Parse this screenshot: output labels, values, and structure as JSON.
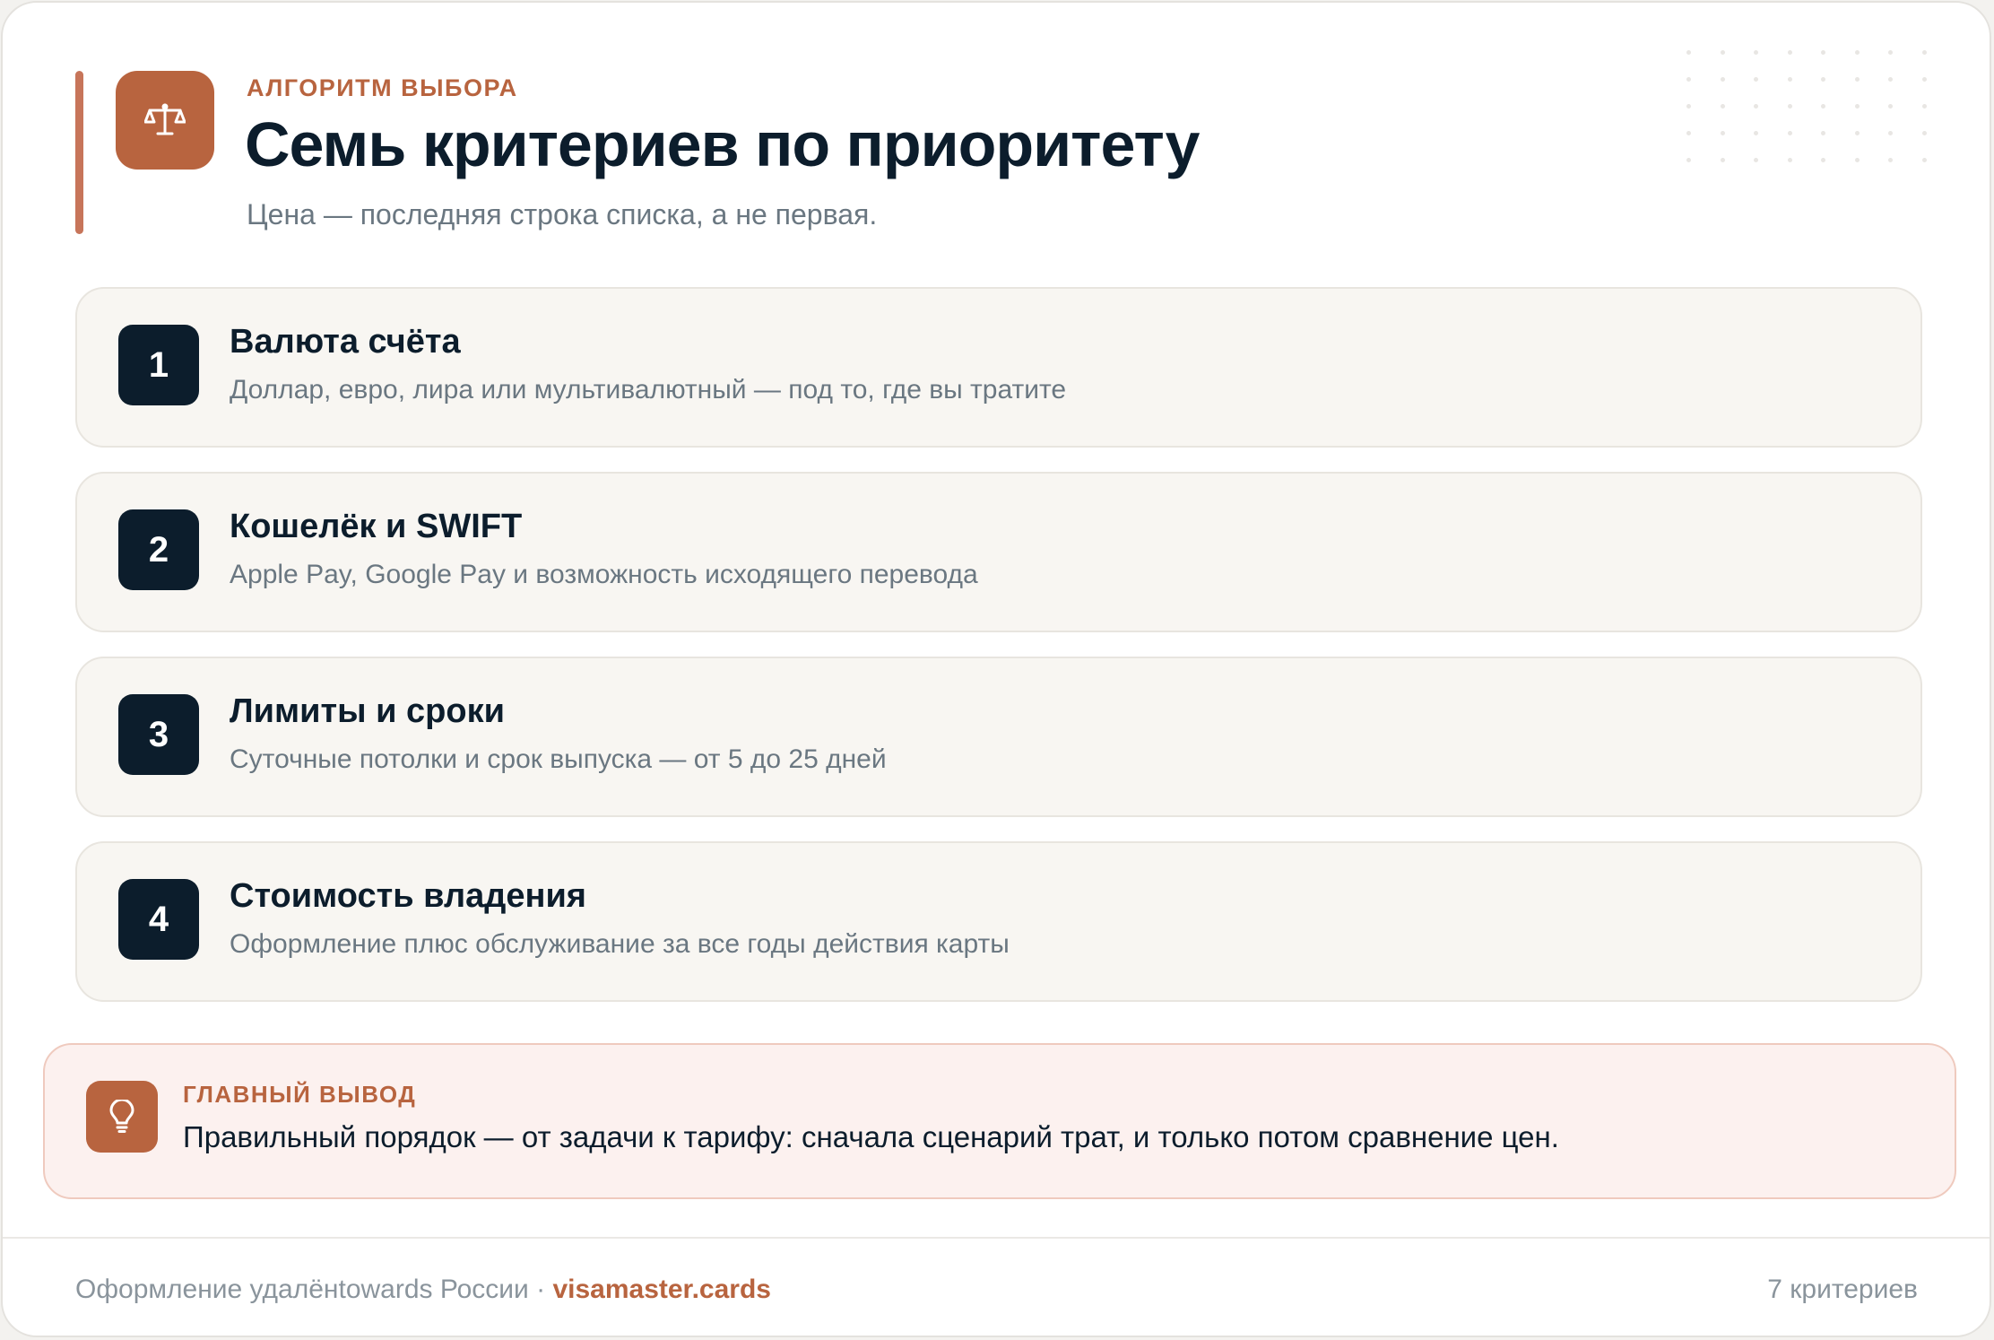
{
  "header": {
    "icon": "scales-icon",
    "kicker": "АЛГОРИТМ ВЫБОРА",
    "title": "Семь критериев по приоритету",
    "subtitle": "Цена — последняя строка списка, а не первая."
  },
  "criteria": [
    {
      "number": "1",
      "title": "Валюта счёта",
      "description": "Доллар, евро, лира или мультивалютный — под то, где вы тратите"
    },
    {
      "number": "2",
      "title": "Кошелёк и SWIFT",
      "description": "Apple Pay, Google Pay и возможность исходящего перевода"
    },
    {
      "number": "3",
      "title": "Лимиты и сроки",
      "description": "Суточные потолки и срок выпуска — от 5 до 25 дней"
    },
    {
      "number": "4",
      "title": "Стоимость владения",
      "description": "Оформление плюс обслуживание за все годы действия карты"
    }
  ],
  "takeaway": {
    "icon": "lightbulb-icon",
    "label": "ГЛАВНЫЙ ВЫВОД",
    "text": "Правильный порядок — от задачи к тарифу: сначала сценарий трат, и только потом сравнение цен."
  },
  "footer": {
    "note": "Оформление удалёнtowards России",
    "separator": " · ",
    "brand": "visamaster.cards",
    "count": "7 критериев"
  },
  "colors": {
    "accent": "#b8643f",
    "dark": "#0c1d2c",
    "muted": "#6a7781",
    "card_bg": "#f8f6f2",
    "takeaway_bg": "#fcf1ef"
  }
}
